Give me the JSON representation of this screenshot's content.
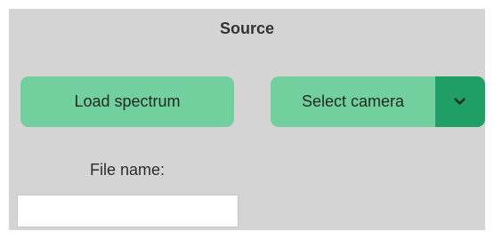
{
  "source": {
    "title": "Source",
    "load_button_label": "Load spectrum",
    "camera_select": {
      "selected": "Select camera",
      "icon": "chevron-down-icon"
    },
    "file_name": {
      "label": "File name:",
      "value": "",
      "placeholder": ""
    }
  },
  "colors": {
    "panel_background": "#d4d4d4",
    "button_fill": "#72d09e",
    "dropdown_accent": "#1f9e66",
    "title_text": "#333333"
  }
}
